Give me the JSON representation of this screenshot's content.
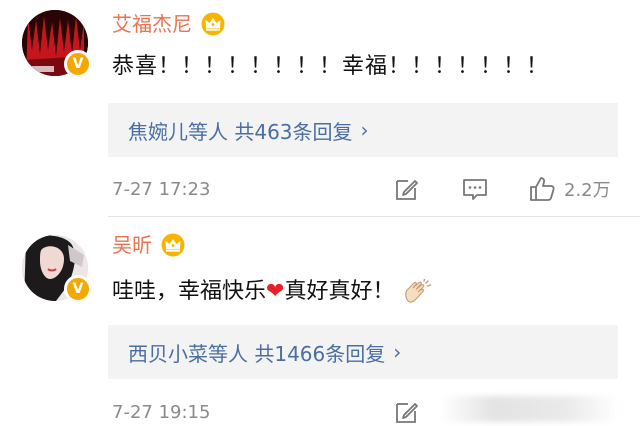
{
  "comments": [
    {
      "author": "艾福杰尼",
      "text": "恭喜！！！！！！！！幸福！！！！！！！",
      "reply_summary": "焦婉儿等人 共463条回复",
      "time": "7-27 17:23",
      "likes": "2.2万",
      "verified_badge": "V",
      "icons": [
        "crown-icon",
        "edit-icon",
        "comment-icon",
        "thumbs-up-icon",
        "chevron-right-icon"
      ]
    },
    {
      "author": "吴昕",
      "text_before_heart": "哇哇，幸福快乐",
      "heart": "❤",
      "text_after_heart": "真好真好！",
      "reply_summary": "西贝小菜等人 共1466条回复",
      "time": "7-27 19:15",
      "verified_badge": "V",
      "icons": [
        "crown-icon",
        "clap-icon",
        "edit-icon",
        "chevron-right-icon"
      ]
    }
  ],
  "colors": {
    "name": "#eb7350",
    "link": "#4a6ea2",
    "reply_box_bg": "#f3f3f3",
    "meta": "#8a8a8a",
    "badge": "#f5a800",
    "heart": "#e8202b"
  },
  "chevron": "›"
}
